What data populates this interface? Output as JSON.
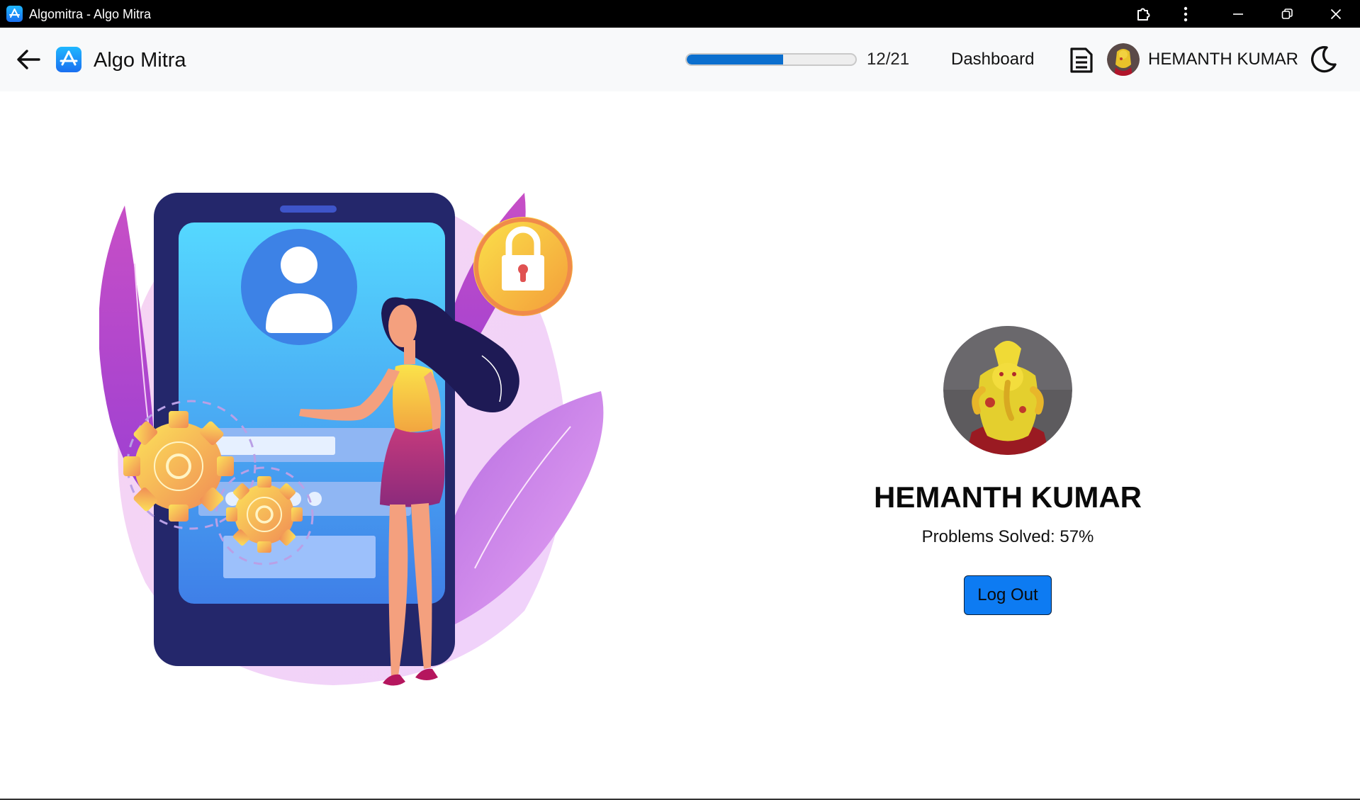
{
  "window": {
    "title": "Algomitra - Algo Mitra",
    "app_icon": "app-store-icon",
    "controls": [
      "extensions-icon",
      "more-vertical-icon",
      "minimize-icon",
      "restore-icon",
      "close-icon"
    ]
  },
  "header": {
    "back_icon": "arrow-left-icon",
    "brand_icon": "app-store-icon",
    "brand_name": "Algo Mitra",
    "progress": {
      "solved": 12,
      "total": 21,
      "label": "12/21",
      "fraction": 0.5714
    },
    "nav_dashboard": "Dashboard",
    "notes_icon": "document-icon",
    "username": "HEMANTH KUMAR",
    "theme_icon": "moon-icon"
  },
  "profile": {
    "name": "HEMANTH KUMAR",
    "stats": "Problems Solved: 57%",
    "logout_label": "Log Out"
  },
  "colors": {
    "titlebar": "#000000",
    "header_bg": "#f8f9fa",
    "progress_fill": "#0b6fce",
    "logout_bg": "#0d7bf2",
    "accent_purple": "#b45ce0"
  }
}
